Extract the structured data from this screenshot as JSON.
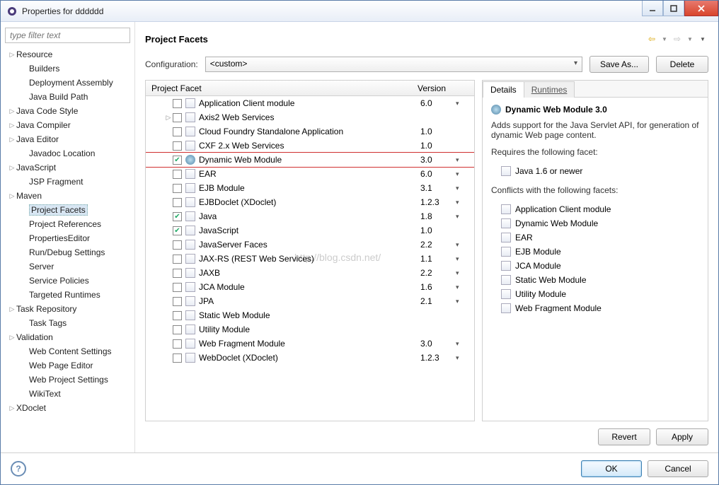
{
  "window": {
    "title": "Properties for dddddd"
  },
  "sidebar": {
    "filter_placeholder": "type filter text",
    "items": [
      {
        "label": "Resource",
        "exp": true,
        "children": false
      },
      {
        "label": "Builders",
        "child": true
      },
      {
        "label": "Deployment Assembly",
        "child": true
      },
      {
        "label": "Java Build Path",
        "child": true
      },
      {
        "label": "Java Code Style",
        "exp": true
      },
      {
        "label": "Java Compiler",
        "exp": true
      },
      {
        "label": "Java Editor",
        "exp": true
      },
      {
        "label": "Javadoc Location",
        "child": true
      },
      {
        "label": "JavaScript",
        "exp": true
      },
      {
        "label": "JSP Fragment",
        "child": true
      },
      {
        "label": "Maven",
        "exp": true
      },
      {
        "label": "Project Facets",
        "child": true,
        "selected": true
      },
      {
        "label": "Project References",
        "child": true
      },
      {
        "label": "PropertiesEditor",
        "child": true
      },
      {
        "label": "Run/Debug Settings",
        "child": true
      },
      {
        "label": "Server",
        "child": true
      },
      {
        "label": "Service Policies",
        "child": true
      },
      {
        "label": "Targeted Runtimes",
        "child": true
      },
      {
        "label": "Task Repository",
        "exp": true
      },
      {
        "label": "Task Tags",
        "child": true
      },
      {
        "label": "Validation",
        "exp": true
      },
      {
        "label": "Web Content Settings",
        "child": true
      },
      {
        "label": "Web Page Editor",
        "child": true
      },
      {
        "label": "Web Project Settings",
        "child": true
      },
      {
        "label": "WikiText",
        "child": true
      },
      {
        "label": "XDoclet",
        "exp": true
      }
    ]
  },
  "main": {
    "title": "Project Facets",
    "config_label": "Configuration:",
    "config_value": "<custom>",
    "save_as": "Save As...",
    "delete": "Delete",
    "col_facet": "Project Facet",
    "col_version": "Version",
    "facets": [
      {
        "name": "Application Client module",
        "ver": "6.0",
        "dd": true,
        "icon": "doc"
      },
      {
        "name": "Axis2 Web Services",
        "ver": "",
        "dd": false,
        "exp": true,
        "icon": "doc"
      },
      {
        "name": "Cloud Foundry Standalone Application",
        "ver": "1.0",
        "dd": false,
        "icon": "doc"
      },
      {
        "name": "CXF 2.x Web Services",
        "ver": "1.0",
        "dd": false,
        "icon": "doc"
      },
      {
        "name": "Dynamic Web Module",
        "ver": "3.0",
        "dd": true,
        "checked": true,
        "highlight": true,
        "icon": "globe"
      },
      {
        "name": "EAR",
        "ver": "6.0",
        "dd": true,
        "icon": "doc"
      },
      {
        "name": "EJB Module",
        "ver": "3.1",
        "dd": true,
        "icon": "doc"
      },
      {
        "name": "EJBDoclet (XDoclet)",
        "ver": "1.2.3",
        "dd": true,
        "icon": "doc"
      },
      {
        "name": "Java",
        "ver": "1.8",
        "dd": true,
        "checked": true,
        "icon": "doc"
      },
      {
        "name": "JavaScript",
        "ver": "1.0",
        "dd": false,
        "checked": true,
        "icon": "doc"
      },
      {
        "name": "JavaServer Faces",
        "ver": "2.2",
        "dd": true,
        "icon": "doc"
      },
      {
        "name": "JAX-RS (REST Web Services)",
        "ver": "1.1",
        "dd": true,
        "icon": "doc"
      },
      {
        "name": "JAXB",
        "ver": "2.2",
        "dd": true,
        "icon": "doc"
      },
      {
        "name": "JCA Module",
        "ver": "1.6",
        "dd": true,
        "icon": "doc"
      },
      {
        "name": "JPA",
        "ver": "2.1",
        "dd": true,
        "icon": "doc"
      },
      {
        "name": "Static Web Module",
        "ver": "",
        "dd": false,
        "icon": "doc"
      },
      {
        "name": "Utility Module",
        "ver": "",
        "dd": false,
        "icon": "doc"
      },
      {
        "name": "Web Fragment Module",
        "ver": "3.0",
        "dd": true,
        "icon": "doc"
      },
      {
        "name": "WebDoclet (XDoclet)",
        "ver": "1.2.3",
        "dd": true,
        "icon": "doc"
      }
    ]
  },
  "details": {
    "tab_details": "Details",
    "tab_runtimes": "Runtimes",
    "title": "Dynamic Web Module 3.0",
    "desc": "Adds support for the Java Servlet API, for generation of dynamic Web page content.",
    "requires_label": "Requires the following facet:",
    "requires": [
      "Java 1.6 or newer"
    ],
    "conflicts_label": "Conflicts with the following facets:",
    "conflicts": [
      "Application Client module",
      "Dynamic Web Module",
      "EAR",
      "EJB Module",
      "JCA Module",
      "Static Web Module",
      "Utility Module",
      "Web Fragment Module"
    ]
  },
  "buttons": {
    "revert": "Revert",
    "apply": "Apply",
    "ok": "OK",
    "cancel": "Cancel"
  },
  "watermark": "http://blog.csdn.net/"
}
